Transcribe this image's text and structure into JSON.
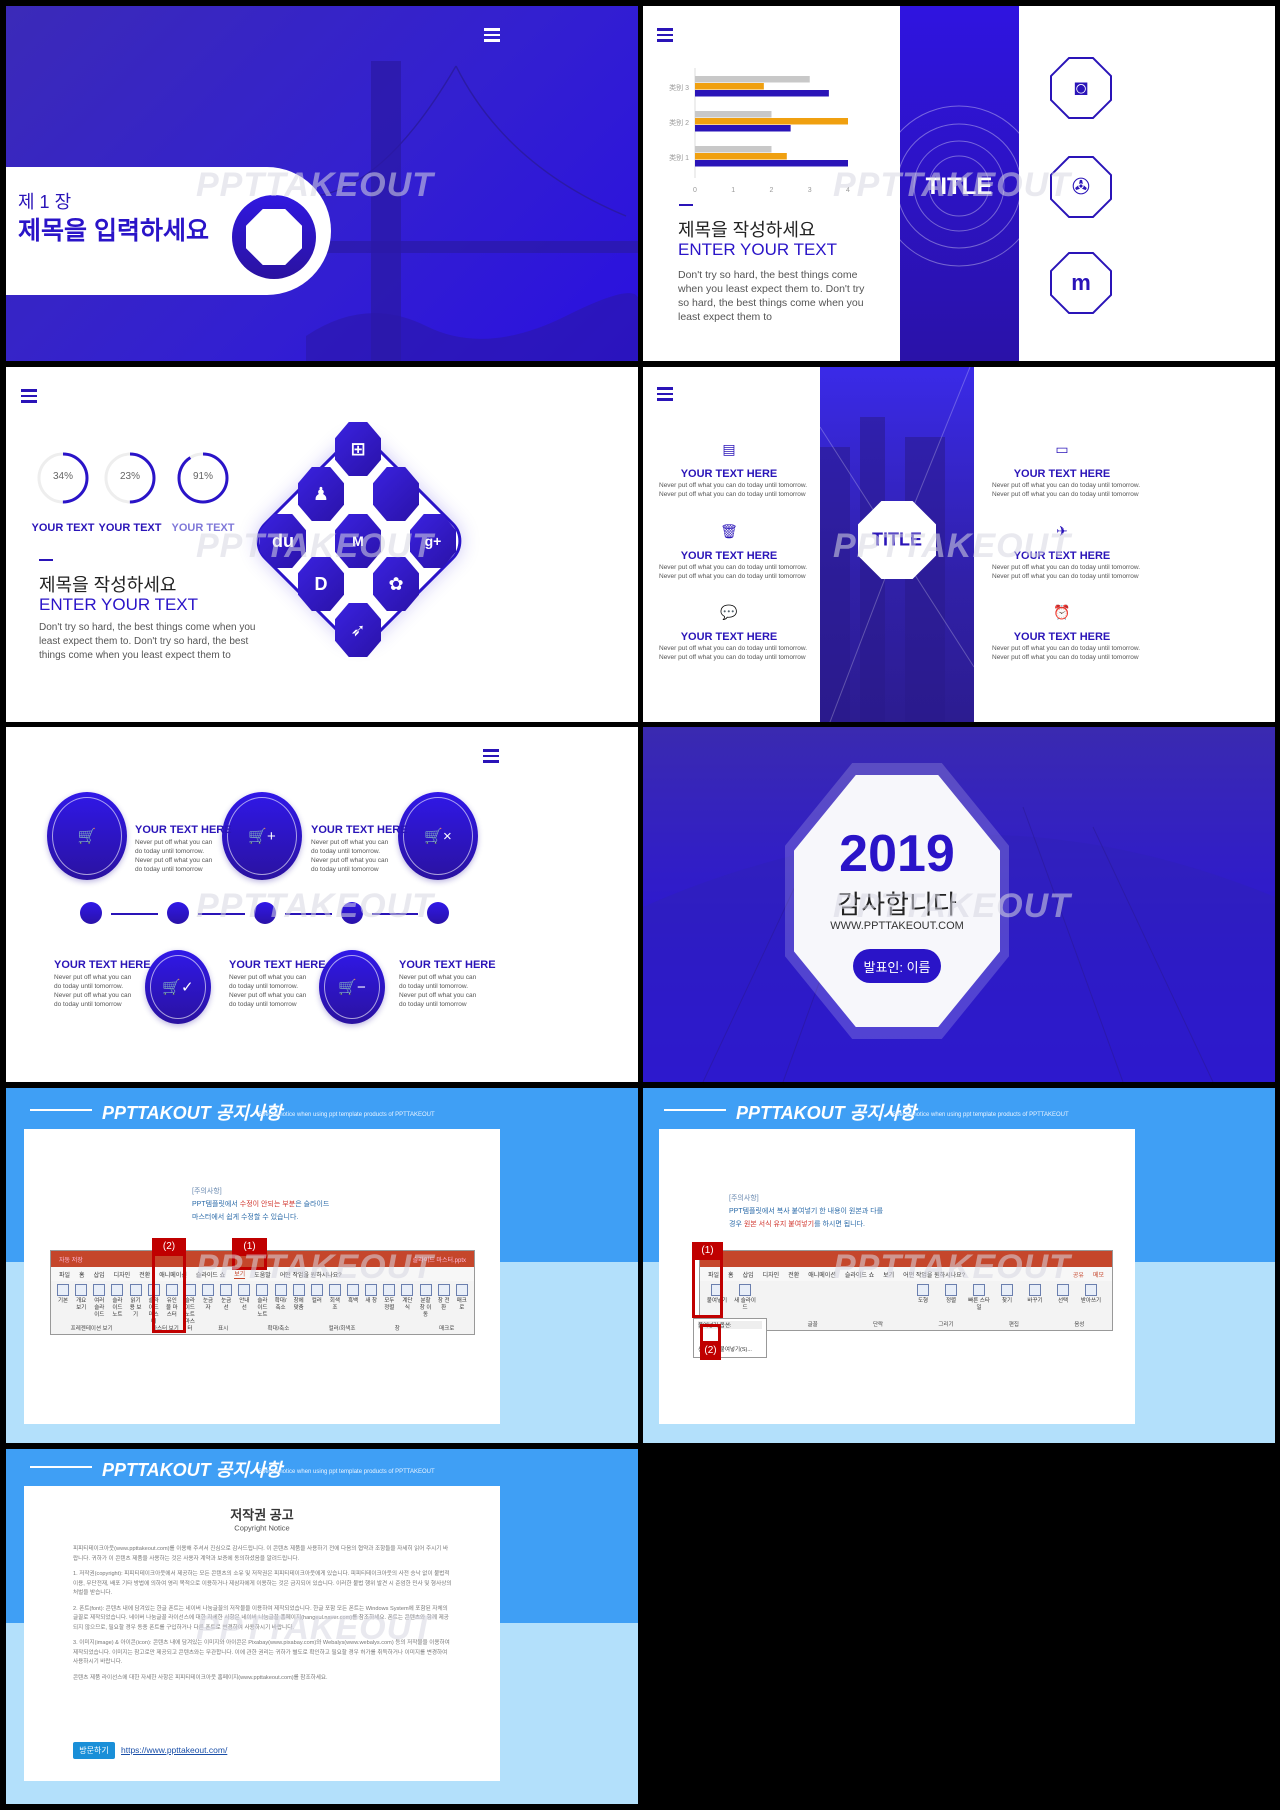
{
  "watermark": "PPTTAKEOUT",
  "colors": {
    "primary": "#2a14c8",
    "notice_blue": "#3f9ff5",
    "notice_light": "#b3e0fb",
    "bar_blue": "#2a14b8",
    "bar_orange": "#f0a010",
    "bar_gray": "#c8c8c8",
    "highlight_red": "#c00000"
  },
  "cover": {
    "chapter": "제 1 장",
    "title": "제목을 입력하세요",
    "menu_icon": "hamburger-icon"
  },
  "chart_slide": {
    "title": "제목을 작성하세요",
    "subtitle": "ENTER YOUR TEXT",
    "body": "Don't try so hard, the best things come when you least expect them to. Don't try so hard, the best things come when you least expect them to",
    "center_title": "TITLE",
    "icons": [
      "instagram-icon",
      "picasa-icon",
      "me2day-icon"
    ]
  },
  "chart_data": {
    "type": "bar",
    "orientation": "horizontal",
    "categories": [
      "类别 1",
      "类别 2",
      "类别 3"
    ],
    "series": [
      {
        "color": "#c8c8c8",
        "values": [
          2,
          2,
          3
        ]
      },
      {
        "color": "#f0a010",
        "values": [
          2.4,
          4,
          1.8
        ]
      },
      {
        "color": "#2a14b8",
        "values": [
          4,
          2.5,
          3.5
        ]
      }
    ],
    "xlim": [
      0,
      4
    ],
    "xticks": [
      "0",
      "1",
      "2",
      "3",
      "4"
    ],
    "grid": false,
    "title": "",
    "xlabel": "",
    "ylabel": ""
  },
  "stats_slide": {
    "rings": [
      {
        "value": "34%",
        "percent": 34,
        "label": "YOUR TEXT"
      },
      {
        "value": "23%",
        "percent": 23,
        "label": "YOUR TEXT"
      },
      {
        "value": "91%",
        "percent": 91,
        "label": "YOUR TEXT"
      }
    ],
    "title": "제목을 작성하세요",
    "subtitle": "ENTER YOUR TEXT",
    "body": "Don't try so hard, the best things come when you least expect them to. Don't try so hard, the best things come when you least expect them to",
    "app_icons": [
      "windows-icon",
      "qq-icon",
      "apple-icon",
      "baidu-icon",
      "medium-icon",
      "google-plus-icon",
      "didi-icon",
      "huawei-icon",
      "kangaroo-icon"
    ],
    "app_glyphs": [
      "⊞",
      "♟",
      "",
      "du",
      "M",
      "g+",
      "D",
      "✿",
      "➶"
    ]
  },
  "features_slide": {
    "center_title": "TITLE",
    "items": [
      {
        "icon": "clipboard-icon",
        "glyph": "▤",
        "heading": "YOUR TEXT HERE",
        "line1": "Never put off what you can do today until tomorrow.",
        "line2": "Never put off what you can do today until tomorrow"
      },
      {
        "icon": "trash-icon",
        "glyph": "🗑",
        "heading": "YOUR TEXT HERE",
        "line1": "Never put off what you can do today until tomorrow.",
        "line2": "Never put off what you can do today until tomorrow"
      },
      {
        "icon": "chat-icon",
        "glyph": "💬",
        "heading": "YOUR TEXT HERE",
        "line1": "Never put off what you can do today until tomorrow.",
        "line2": "Never put off what you can do today until tomorrow"
      },
      {
        "icon": "card-icon",
        "glyph": "▭",
        "heading": "YOUR TEXT HERE",
        "line1": "Never put off what you can do today until tomorrow.",
        "line2": "Never put off what you can do today until tomorrow"
      },
      {
        "icon": "airplane-icon",
        "glyph": "✈",
        "heading": "YOUR TEXT HERE",
        "line1": "Never put off what you can do today until tomorrow.",
        "line2": "Never put off what you can do today until tomorrow"
      },
      {
        "icon": "alarm-clock-icon",
        "glyph": "⏰",
        "heading": "YOUR TEXT HERE",
        "line1": "Never put off what you can do today until tomorrow.",
        "line2": "Never put off what you can do today until tomorrow"
      }
    ]
  },
  "timeline_slide": {
    "items": [
      {
        "icon": "cart-icon",
        "glyph": "🛒",
        "heading": "YOUR TEXT HERE",
        "body": "Never put off what you can do today until tomorrow. Never put off what you can do today until tomorrow"
      },
      {
        "icon": "cart-check-icon",
        "glyph": "🛒✓",
        "heading": "YOUR TEXT HERE",
        "body": "Never put off what you can do today until tomorrow. Never put off what you can do today until tomorrow"
      },
      {
        "icon": "cart-plus-icon",
        "glyph": "🛒+",
        "heading": "YOUR TEXT HERE",
        "body": "Never put off what you can do today until tomorrow. Never put off what you can do today until tomorrow"
      },
      {
        "icon": "cart-minus-icon",
        "glyph": "🛒−",
        "heading": "YOUR TEXT HERE",
        "body": "Never put off what you can do today until tomorrow. Never put off what you can do today until tomorrow"
      },
      {
        "icon": "cart-remove-icon",
        "glyph": "🛒×",
        "heading": "YOUR TEXT HERE",
        "body": "Never put off what you can do today until tomorrow. Never put off what you can do today until tomorrow"
      }
    ]
  },
  "thanks_slide": {
    "year": "2019",
    "thanks": "감사합니다",
    "url": "WWW.PPTTAKEOUT.COM",
    "presenter": "발표인: 이름"
  },
  "notice_header": {
    "title": "PPTTAKOUT 공지사항",
    "subtitle": "Special notice when using ppt template products of PPTTAKEOUT"
  },
  "notice_master": {
    "label": "[주의사항]",
    "line1_a": "PPT템플릿에서 ",
    "line1_red": "수정이 안되는 부분",
    "line1_b": "은 슬라이드",
    "line2": "마스터에서 쉽게 수정할 수 있습니다.",
    "ribbon": {
      "filename": "슬라이드 마스터.pptx",
      "autosave": "자동 저장",
      "tabs": [
        "파일",
        "홈",
        "삽입",
        "디자인",
        "전환",
        "애니메이션",
        "슬라이드 쇼",
        "보기",
        "도움말",
        "어떤 작업을 원하시나요?"
      ],
      "buttons": [
        "기본",
        "개요 보기",
        "여러 슬라이드",
        "슬라이드 노트",
        "읽기용 보기",
        "슬라이드 마스터",
        "유인물 마스터",
        "슬라이드 노트 마스터",
        "눈금자",
        "눈금선",
        "안내선",
        "슬라이드 노트",
        "확대/축소",
        "창에 맞춤",
        "컬러",
        "회색조",
        "흑백",
        "새 창",
        "모두 정렬",
        "계단식",
        "분할창 이동",
        "창 전환",
        "매크로"
      ],
      "groups": [
        "프레젠테이션 보기",
        "마스터 보기",
        "표시",
        "확대/축소",
        "컬러/회색조",
        "창",
        "매크로"
      ]
    },
    "tag1": "(1)",
    "tag2": "(2)"
  },
  "notice_paste": {
    "label": "[주의사항]",
    "line1": "PPT템플릿에서 복사 붙여넣기 한 내용이 원본과 다를",
    "line2_a": "경우 ",
    "line2_red": "원본 서식 유지 붙여넣기",
    "line2_b": "를 하시면 됩니다.",
    "ribbon": {
      "tabs": [
        "파일",
        "홈",
        "삽입",
        "디자인",
        "전환",
        "애니메이션",
        "슬라이드 쇼",
        "보기",
        "어떤 작업을 원하시나요?"
      ],
      "share": "공유",
      "comment": "메모",
      "buttons": [
        "붙여넣기",
        "새 슬라이드",
        "도형",
        "정렬",
        "빠른 스타일",
        "찾기",
        "바꾸기",
        "선택",
        "받아쓰기"
      ],
      "groups": [
        "글꼴",
        "단락",
        "그리기",
        "편집",
        "음성"
      ],
      "menu_title": "붙여넣기 옵션:",
      "menu_item": "선택하여 붙여넣기(S)..."
    },
    "tag1": "(1)",
    "tag2": "(2)"
  },
  "copyright": {
    "title": "저작권 공고",
    "subtitle": "Copyright Notice",
    "paragraphs": [
      "피피티테이크아웃(www.ppttakeout.com)를 이용해 주셔서 진심으로 감사드립니다. 이 콘텐츠 제품을 사용하기 전에 다음의 협약과 조항들을 자세히 읽어 주시기 바랍니다. 귀하가 이 콘텐츠 제품을 사용하는 것은 사용자 계약과 보증에 동의하셨음을 알려드립니다.",
      "1. 저작권(copyright): 피피티테이크아웃에서 제공하는 모든 콘텐츠의 소유 및 저작권은 피피티테이크아웃에게 있습니다. 피피티테이크아웃의 사전 승낙 없이 불법적 이용, 무단전재, 배포 기타 방법에 의하여 영리 목적으로 이용하거나 제삼자에게 이용하는 것은 금지되어 있습니다. 이러한 불법 행위 발견 시 준엄한 민사 및 형사상의 처벌을 받습니다.",
      "2. 폰트(font): 콘텐츠 내에 담겨있는 한글 폰트는 네이버 나눔글꼴의 저작물을 이용하여 제작되었습니다. 한글 포함 모든 폰트는 Windows System에 포함된 자체의 글꼴로 제작되었습니다. 네이버 나눔글꼴 라이선스에 대한 자세한 사항은 네이버 나눔글꼴 홈페이지(hangeul.naver.com)를 참조하세요. 폰트는 콘텐츠와 함께 제공되지 않으므로, 필요할 경우 동종 폰트를 구입하거나 다른 폰트로 변경하여 사용하시기 바랍니다.",
      "3. 이미지(image) & 아이콘(icon): 콘텐츠 내에 담겨있는 이미지와 아이콘은 Pixabay(www.pixabay.com)와 Webalys(www.webalys.com) 등의 저작물을 이용하여 제작되었습니다. 이미지는 참고로만 제공되고 콘텐츠와는 무관합니다. 이에 관한 권리는 귀하가 별도로 확인하고 필요할 경우 허가를 취득하거나 이미지를 변경하여 사용하시기 바랍니다.",
      "콘텐츠 제품 라이선스에 대한 자세한 사항은 피피티테이크아웃 홈페이지(www.ppttakeout.com)를 참조하세요."
    ],
    "visit_button": "방문하기",
    "link": "https://www.ppttakeout.com/"
  }
}
